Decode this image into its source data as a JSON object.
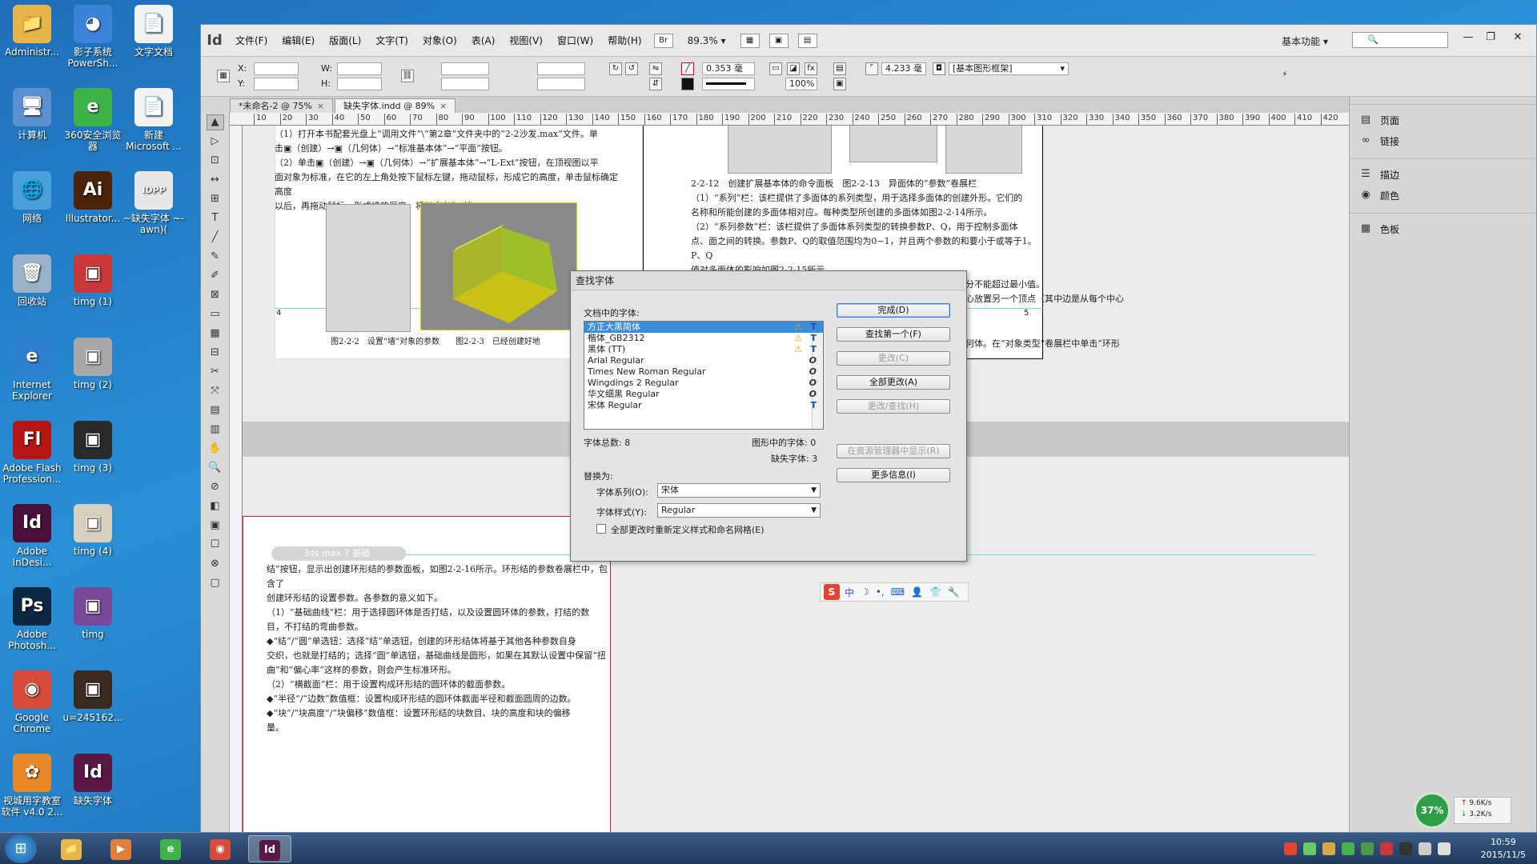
{
  "desktop": {
    "icons": [
      {
        "label": "Administr...",
        "glyph": "📁",
        "color": "#e8b64a"
      },
      {
        "label": "影子系统 PowerSh...",
        "glyph": "◕",
        "color": "#3b83d6"
      },
      {
        "label": "文字文档",
        "glyph": "📄",
        "color": "#f2f2f2"
      },
      {
        "label": "计算机",
        "glyph": "🖥",
        "color": "#5a8fd0"
      },
      {
        "label": "360安全浏览器",
        "glyph": "e",
        "color": "#3fb24a"
      },
      {
        "label": "新建 Microsoft ...",
        "glyph": "📄",
        "color": "#f2f2f2"
      },
      {
        "label": "网络",
        "glyph": "🌐",
        "color": "#4aa0d8"
      },
      {
        "label": "Illustrator...",
        "glyph": "Ai",
        "color": "#4a2308"
      },
      {
        "label": "~缺失字体 ~-awn)(",
        "glyph": "IDPP",
        "color": "#e8e8e8"
      },
      {
        "label": "回收站",
        "glyph": "🗑",
        "color": "#9ab2c8"
      },
      {
        "label": "timg (1)",
        "glyph": "▣",
        "color": "#c8373a"
      },
      {
        "label": "Internet Explorer",
        "glyph": "e",
        "color": "#2f7fd0"
      },
      {
        "label": "timg (2)",
        "glyph": "▣",
        "color": "#a8a8a8"
      },
      {
        "label": "Adobe Flash Profession...",
        "glyph": "Fl",
        "color": "#b51515"
      },
      {
        "label": "timg (3)",
        "glyph": "▣",
        "color": "#2a2a2a"
      },
      {
        "label": "Adobe InDesi...",
        "glyph": "Id",
        "color": "#4a0f3a"
      },
      {
        "label": "timg (4)",
        "glyph": "▣",
        "color": "#d9cfc0"
      },
      {
        "label": "Adobe Photosh...",
        "glyph": "Ps",
        "color": "#0b2742"
      },
      {
        "label": "timg",
        "glyph": "▣",
        "color": "#7a4a9a"
      },
      {
        "label": "Google Chrome",
        "glyph": "◉",
        "color": "#d64b3a"
      },
      {
        "label": "u=245162...",
        "glyph": "▣",
        "color": "#3a2a20"
      },
      {
        "label": "视城用字教室 软件 v4.0 2...",
        "glyph": "✿",
        "color": "#e88a2a"
      },
      {
        "label": "缺失字体",
        "glyph": "Id",
        "color": "#5a1844"
      }
    ]
  },
  "app": {
    "logo": "Id",
    "menus": [
      "文件(F)",
      "编辑(E)",
      "版面(L)",
      "文字(T)",
      "对象(O)",
      "表(A)",
      "视图(V)",
      "窗口(W)",
      "帮助(H)"
    ],
    "zoom": "89.3%",
    "workspace": "基本功能",
    "window_buttons": [
      "—",
      "❐",
      "✕"
    ],
    "control": {
      "x_label": "X:",
      "y_label": "Y:",
      "w_label": "W:",
      "h_label": "H:",
      "stroke_weight": "0.353 毫",
      "scale": "100%",
      "size": "4.233 毫",
      "frame_style": "[基本图形框架]"
    },
    "tabs": [
      {
        "label": "*未命名-2 @ 75%",
        "close": "×"
      },
      {
        "label": "缺失字体.indd @ 89%",
        "close": "×"
      }
    ],
    "ruler_ticks": [
      "10",
      "20",
      "30",
      "40",
      "50",
      "60",
      "70",
      "80",
      "90",
      "100",
      "110",
      "120",
      "130",
      "140",
      "150",
      "160",
      "170",
      "180",
      "190",
      "200",
      "210",
      "220",
      "230",
      "240",
      "250",
      "260",
      "270",
      "280",
      "290",
      "300",
      "310",
      "320",
      "330",
      "340",
      "350",
      "360",
      "370",
      "380",
      "390",
      "400",
      "410",
      "420"
    ],
    "tools": [
      "▲",
      "▷",
      "⊡",
      "↔",
      "⊞",
      "T",
      "╱",
      "✎",
      "✐",
      "⊠",
      "▭",
      "▦",
      "⊟",
      "✂",
      "⤧",
      "▤",
      "▥",
      "✋",
      "🔍",
      "⊘",
      "◧",
      "▣",
      "☐",
      "⊗",
      "▢"
    ],
    "panel": [
      {
        "icon": "▤",
        "label": "页面"
      },
      {
        "icon": "∞",
        "label": "链接"
      },
      {
        "icon": "☰",
        "label": "描边"
      },
      {
        "icon": "◉",
        "label": "颜色"
      },
      {
        "icon": "▦",
        "label": "色板"
      }
    ],
    "document": {
      "top_left_lines": [
        "（1）打开本书配套光盘上“调用文件”\\“第2章”文件夹中的“2-2沙发.max”文件。单",
        "击▣（创建）→▣（几何体）→“标准基本体”→“平面”按钮。",
        "（2）单击▣（创建）→▣（几何体）→“扩展基本体”→“L-Ext”按钮，在顶视图以平",
        "面对象为标准，在它的左上角处按下鼠标左键，拖动鼠标，形成它的高度，单击鼠标确定高度",
        "以后，再拖动鼠标，形成墙的厚度，将其命名为“墙”"
      ],
      "captions_left": "图2-2-2　设置“墙”对象的参数　　图2-2-3　已经创建好地",
      "top_right_lines": [
        "2-2-12　创建扩展基本体的命令面板　图2-2-13　异面体的“参数”卷展栏",
        "（1）“系列”栏：该栏提供了多面体的系列类型，用于选择多面体的创建外形。它们的",
        "名称和所能创建的多面体相对应。每种类型所创建的多面体如图2-2-14所示。",
        "（2）“系列参数”栏：该栏提供了多面体系列类型的转换参数P、Q，用于控制多面体",
        "点、面之间的转换。参数P、Q的取值范围均为0~1，并且两个参数的和要小于或等于1。P、Q",
        "值对多面体的影响如图2-2-15所示。"
      ],
      "right_partial_lines": [
        "面的细分不能超过最小值。",
        "过在中心放置另一个顶点（其中边是从每个中心",
        "三维几何体。在“对象类型”卷展栏中单击“环形"
      ],
      "page_num_left": "4",
      "page_num_right": "5",
      "header_bar": "3ds max 7 基础",
      "bottom_lines": [
        "结”按钮，显示出创建环形结的参数面板，如图2-2-16所示。环形结的参数卷展栏中，包含了",
        "创建环形结的设置参数。各参数的意义如下。",
        "（1）“基础曲线”栏：用于选择圆环体是否打结，以及设置圆环体的参数，打结的数",
        "目，不打结的弯曲参数。",
        "◆“结”/“圆”单选钮：选择“结”单选钮，创建的环形结体将基于其他各种参数自身",
        "交织，也就是打结的；选择“圆”单选钮，基础曲线是圆形，如果在其默认设置中保留“扭",
        "曲”和“偏心率”这样的参数，则会产生标准环形。",
        "（2）“横截面”栏：用于设置构成环形结的圆环体的截面参数。",
        "◆“半径”/“边数”数值框：设置构成环形结的圆环体截面半径和截面圆周的边数。",
        "◆“块”/“块高度”/“块偏移”数值框：设置环形结的块数目、块的高度和块的偏移",
        "量。"
      ]
    }
  },
  "dialog": {
    "title": "查找字体",
    "list_label": "文档中的字体:",
    "fonts": [
      {
        "name": "方正大黑简体",
        "missing": true,
        "type": "T",
        "selected": true
      },
      {
        "name": "楷体_GB2312",
        "missing": true,
        "type": "T",
        "selected": false
      },
      {
        "name": "黑体 (TT)",
        "missing": true,
        "type": "T",
        "selected": false
      },
      {
        "name": "Arial Regular",
        "missing": false,
        "type": "O",
        "selected": false
      },
      {
        "name": "Times New Roman Regular",
        "missing": false,
        "type": "O",
        "selected": false
      },
      {
        "name": "Wingdings 2 Regular",
        "missing": false,
        "type": "O",
        "selected": false
      },
      {
        "name": "华文细黑 Regular",
        "missing": false,
        "type": "O",
        "selected": false
      },
      {
        "name": "宋体 Regular",
        "missing": false,
        "type": "T",
        "selected": false
      }
    ],
    "warn_glyph": "⚠",
    "total_fonts": "字体总数: 8",
    "fonts_in_graphics": "图形中的字体: 0",
    "missing_fonts": "缺失字体: 3",
    "replace_with": "替换为:",
    "family_label": "字体系列(O):",
    "family_value": "宋体",
    "style_label": "字体样式(Y):",
    "style_value": "Regular",
    "redefine_label": "全部更改时重新定义样式和命名网格(E)",
    "buttons": {
      "done": "完成(D)",
      "find_first": "查找第一个(F)",
      "change": "更改(C)",
      "change_all": "全部更改(A)",
      "change_find": "更改/查找(H)",
      "reveal": "在资源管理器中显示(R)",
      "more_info": "更多信息(I)"
    }
  },
  "ime": {
    "logo": "S",
    "items": [
      "中",
      "☽",
      "•,",
      "⌨",
      "👤",
      "👕",
      "🔧"
    ]
  },
  "net": {
    "percent": "37%",
    "up": "9.6K/s",
    "down": "3.2K/s"
  },
  "taskbar": {
    "start": "⊞",
    "items": [
      {
        "glyph": "📁",
        "color": "#e8b64a"
      },
      {
        "glyph": "▶",
        "color": "#e0803a"
      },
      {
        "glyph": "e",
        "color": "#3fb24a"
      },
      {
        "glyph": "◉",
        "color": "#d64b3a"
      },
      {
        "glyph": "Id",
        "color": "#5a1844"
      }
    ],
    "time": "10:59",
    "date": "2015/11/5"
  }
}
